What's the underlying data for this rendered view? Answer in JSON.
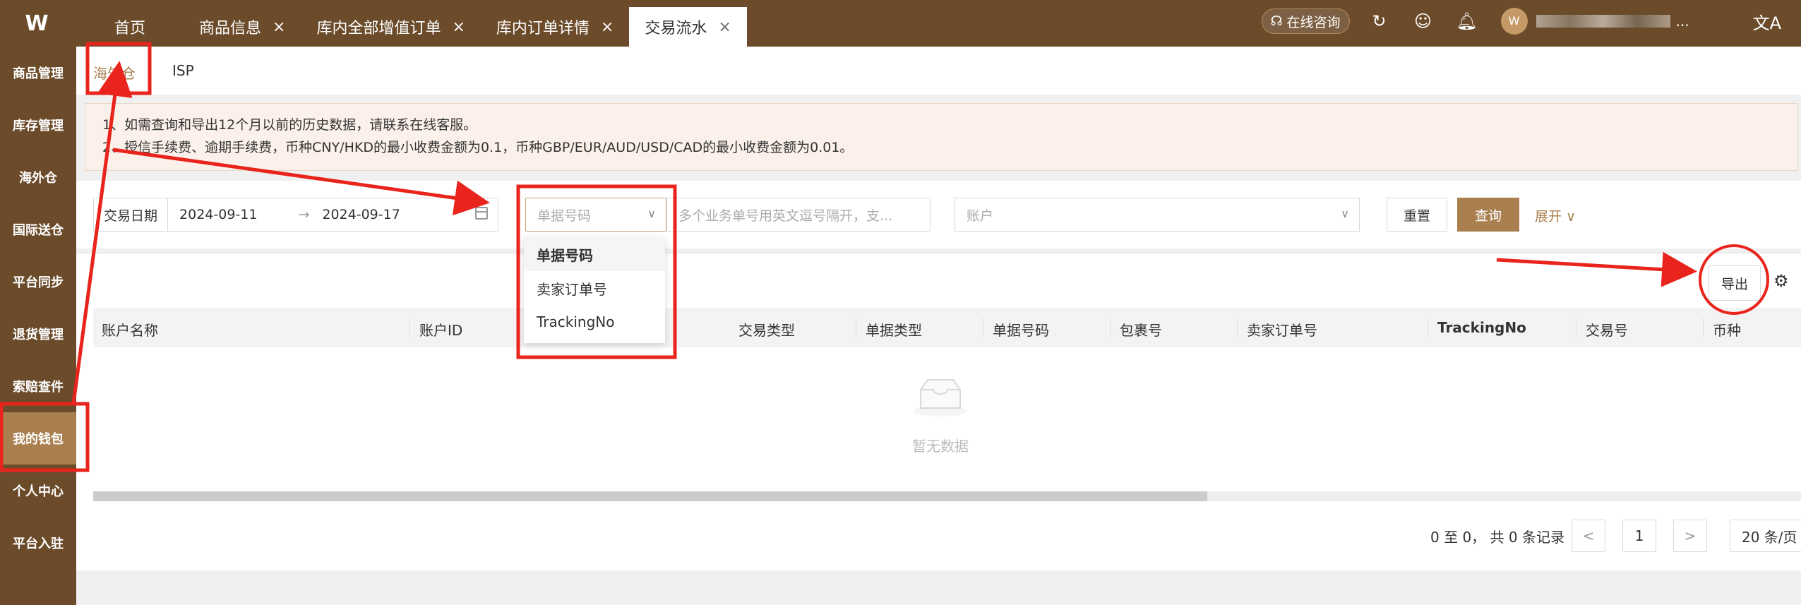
{
  "app": {
    "logo_text": "W"
  },
  "tabs": [
    {
      "label": "首页"
    },
    {
      "label": "商品信息",
      "close": "×"
    },
    {
      "label": "库内全部增值订单",
      "close": "×"
    },
    {
      "label": "库内订单详情",
      "close": "×"
    },
    {
      "label": "交易流水",
      "close": "×",
      "active": true
    }
  ],
  "header": {
    "consult_label": "在线咨询",
    "user_suffix": "..."
  },
  "sidebar": {
    "items": [
      {
        "label": "商品管理"
      },
      {
        "label": "库存管理"
      },
      {
        "label": "海外仓"
      },
      {
        "label": "国际送仓"
      },
      {
        "label": "平台同步"
      },
      {
        "label": "退货管理"
      },
      {
        "label": "索赔查件"
      },
      {
        "label": "我的钱包",
        "active": true
      },
      {
        "label": "个人中心"
      },
      {
        "label": "平台入驻"
      }
    ]
  },
  "subtabs": [
    {
      "label": "海外仓",
      "active": true
    },
    {
      "label": "ISP"
    }
  ],
  "notice": {
    "line1": "1、如需查询和导出12个月以前的历史数据，请联系在线客服。",
    "line2": "2、授信手续费、逾期手续费，币种CNY/HKD的最小收费金额为0.1，币种GBP/EUR/AUD/USD/CAD的最小收费金额为0.01。"
  },
  "filter": {
    "date_label": "交易日期",
    "date_start": "2024-09-11",
    "date_arrow": "→",
    "date_end": "2024-09-17",
    "doc_type_placeholder": "单据号码",
    "order_placeholder": "多个业务单号用英文逗号隔开，支...",
    "account_placeholder": "账户",
    "reset_label": "重置",
    "query_label": "查询",
    "expand_label": "展开"
  },
  "dropdown": {
    "options": [
      "单据号码",
      "卖家订单号",
      "TrackingNo"
    ],
    "selected": "单据号码"
  },
  "table": {
    "export_label": "导出",
    "columns": [
      "账户名称",
      "账户ID",
      "交易类型",
      "单据类型",
      "单据号码",
      "包裹号",
      "卖家订单号",
      "TrackingNo",
      "交易号",
      "币种"
    ],
    "empty_text": "暂无数据"
  },
  "pagination": {
    "summary": "0 至 0， 共 0 条记录",
    "prev": "<",
    "page": "1",
    "next": ">",
    "page_size": "20 条/页"
  },
  "colors": {
    "brand": "#6b4b2a",
    "accent": "#a97f4f",
    "annotation": "#e8241c"
  }
}
